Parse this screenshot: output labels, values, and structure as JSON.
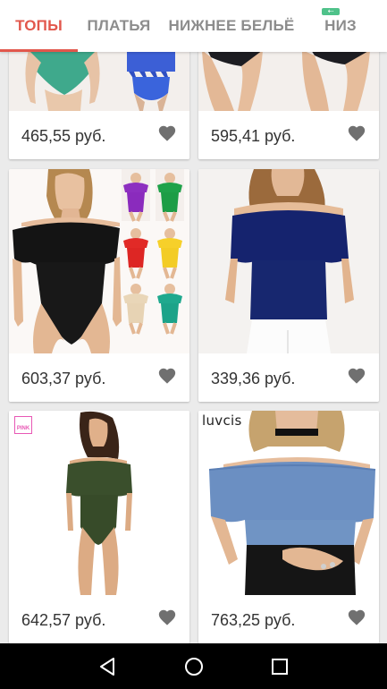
{
  "tabs": [
    {
      "label": "ТОПЫ",
      "active": true
    },
    {
      "label": "ПЛАТЬЯ",
      "active": false
    },
    {
      "label": "НИЖНЕЕ БЕЛЬЁ",
      "active": false
    },
    {
      "label": "НИЗ",
      "active": false
    }
  ],
  "colors": {
    "accent": "#e2574c",
    "tab_inactive": "#8d8d8d",
    "badge": "#4fc28a",
    "heart": "#707070"
  },
  "products": [
    {
      "price": "465,55 руб.",
      "icon": "heart-icon",
      "brand": ""
    },
    {
      "price": "595,41 руб.",
      "icon": "heart-icon",
      "brand": ""
    },
    {
      "price": "603,37 руб.",
      "icon": "heart-icon",
      "brand": ""
    },
    {
      "price": "339,36 руб.",
      "icon": "heart-icon",
      "brand": ""
    },
    {
      "price": "642,57 руб.",
      "icon": "heart-icon",
      "brand": "PINK"
    },
    {
      "price": "763,25 руб.",
      "icon": "heart-icon",
      "brand": "luvcis"
    }
  ],
  "navbar": {
    "back_icon": "back-triangle-icon",
    "home_icon": "home-circle-icon",
    "recents_icon": "recents-square-icon"
  }
}
